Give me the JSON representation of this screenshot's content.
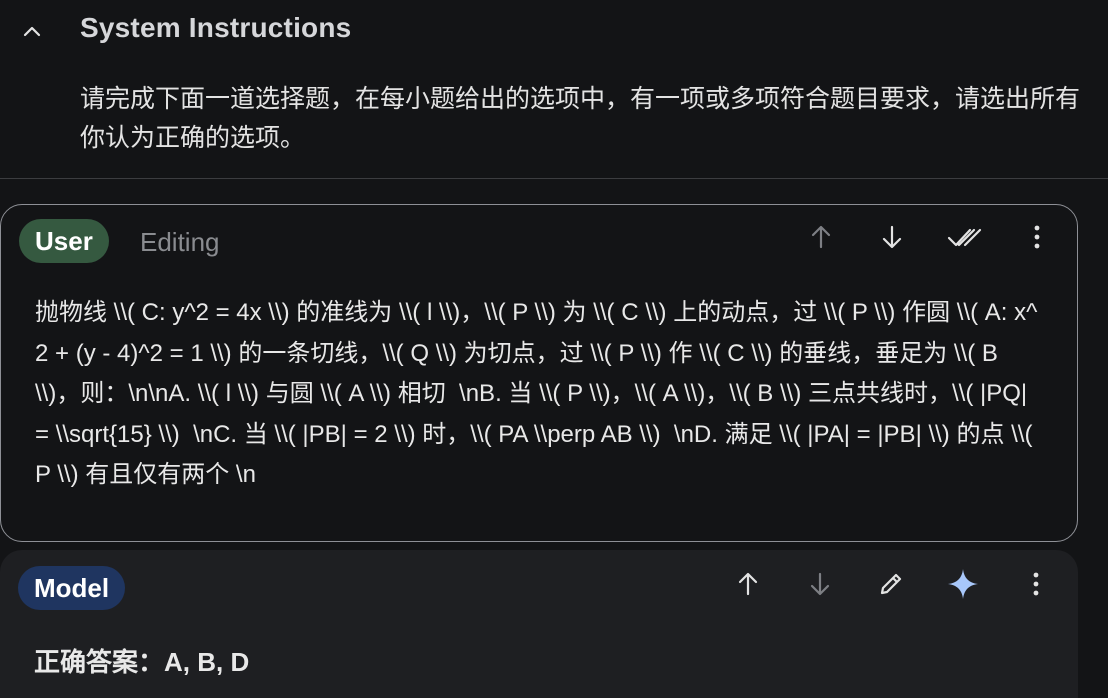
{
  "system": {
    "title": "System Instructions",
    "text": "请完成下面一道选择题，在每小题给出的选项中，有一项或多项符合题目要求，请选出所有你认为正确的选项。"
  },
  "user": {
    "role": "User",
    "status": "Editing",
    "text": "抛物线 \\\\( C: y^2 = 4x \\\\) 的准线为 \\\\( l \\\\)，\\\\( P \\\\) 为 \\\\( C \\\\) 上的动点，过 \\\\( P \\\\) 作圆 \\\\( A: x^2 + (y - 4)^2 = 1 \\\\) 的一条切线，\\\\( Q \\\\) 为切点，过 \\\\( P \\\\) 作 \\\\( C \\\\) 的垂线，垂足为 \\\\( B \\\\)，则：\\n\\nA. \\\\( l \\\\) 与圆 \\\\( A \\\\) 相切  \\nB. 当 \\\\( P \\\\)，\\\\( A \\\\)，\\\\( B \\\\) 三点共线时，\\\\( |PQ| = \\\\sqrt{15} \\\\)  \\nC. 当 \\\\( |PB| = 2 \\\\) 时，\\\\( PA \\\\perp AB \\\\)  \\nD. 满足 \\\\( |PA| = |PB| \\\\) 的点 \\\\( P \\\\) 有且仅有两个 \\n",
    "actions": [
      "arrow-up-icon",
      "arrow-down-icon",
      "done-all-icon",
      "more-vert-icon"
    ]
  },
  "model": {
    "role": "Model",
    "answer": "正确答案：A, B, D",
    "actions": [
      "arrow-up-icon",
      "arrow-down-icon",
      "edit-icon",
      "sparkle-icon",
      "more-vert-icon"
    ]
  },
  "colors": {
    "background": "#131416",
    "user_chip": "#355940",
    "model_chip": "#1f3560",
    "sparkle": "#a8c7fa"
  }
}
